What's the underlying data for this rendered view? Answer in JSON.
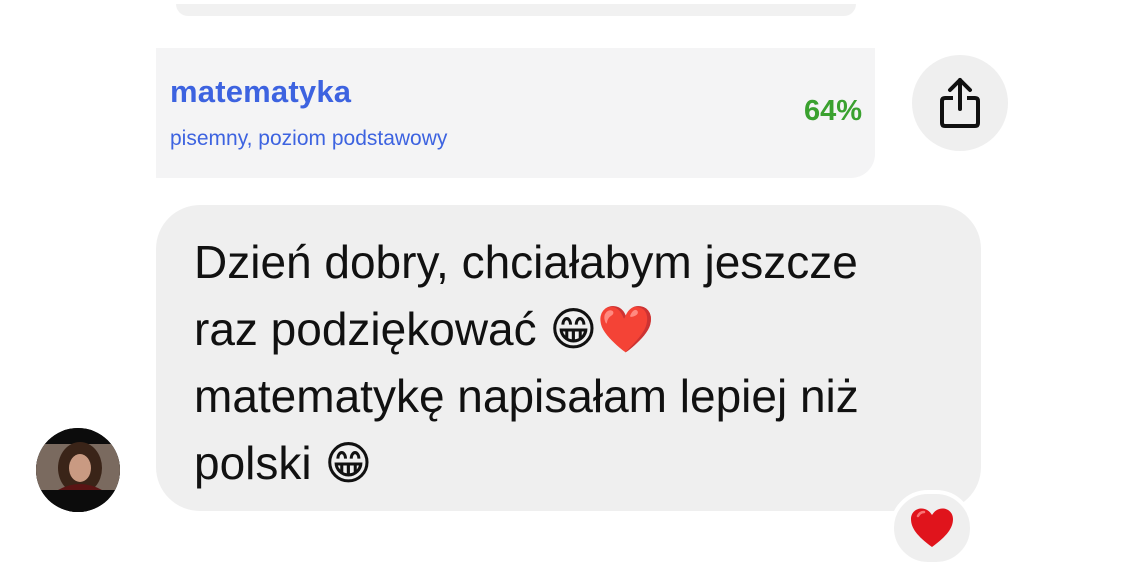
{
  "exam_card": {
    "subject": "matematyka",
    "level": "pisemny, poziom podstawowy",
    "score": "64%",
    "accent_color": "#3d63e0",
    "score_color": "#3aa12f"
  },
  "share": {
    "icon": "share-icon"
  },
  "message": {
    "line_1": "Dzień dobry, chciałabym jeszcze",
    "line_2": "raz podziękować 😁❤️",
    "line_3": "matematykę napisałam lepiej niż",
    "line_4": "polski 😁",
    "bubble_color": "#efefef"
  },
  "sender": {
    "avatar_icon": "avatar"
  },
  "reaction": {
    "emoji": "❤️",
    "icon": "heart-icon"
  }
}
